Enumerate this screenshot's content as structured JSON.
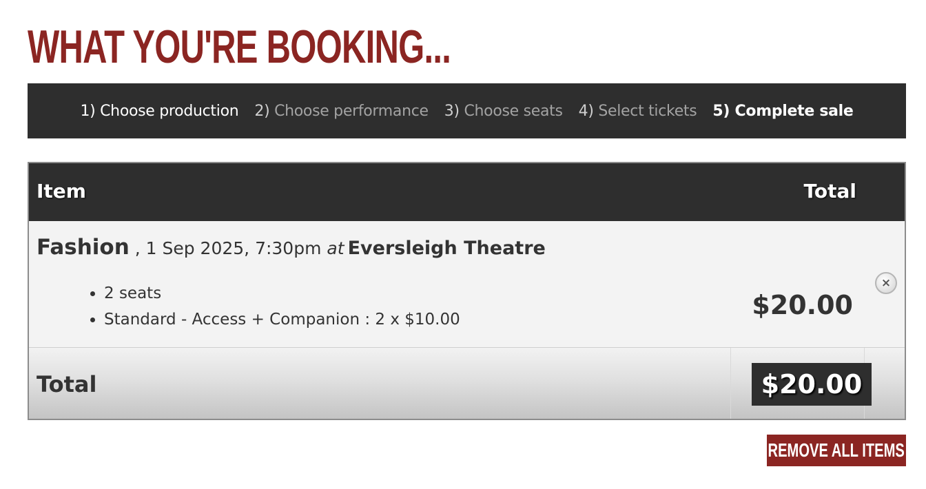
{
  "page": {
    "title": "WHAT YOU'RE BOOKING..."
  },
  "steps": [
    {
      "num": "1)",
      "label": "Choose production",
      "state": "done"
    },
    {
      "num": "2)",
      "label": "Choose performance",
      "state": "inactive"
    },
    {
      "num": "3)",
      "label": "Choose seats",
      "state": "inactive"
    },
    {
      "num": "4)",
      "label": "Select tickets",
      "state": "inactive"
    },
    {
      "num": "5)",
      "label": "Complete sale",
      "state": "active"
    }
  ],
  "cart": {
    "header": {
      "item": "Item",
      "total": "Total"
    },
    "item": {
      "production": "Fashion",
      "date_time": " , 1 Sep 2025, 7:30pm ",
      "at": "at",
      "venue": "Eversleigh Theatre",
      "details": [
        "2 seats",
        "Standard - Access + Companion : 2 x $10.00"
      ],
      "price": "$20.00",
      "remove_symbol": "×"
    },
    "footer": {
      "label": "Total",
      "total": "$20.00"
    }
  },
  "actions": {
    "remove_all": "REMOVE ALL ITEMS"
  },
  "colors": {
    "brand": "#8b2522",
    "dark_bar": "#2e2e2e"
  },
  "icons": {
    "remove_item": "close-circle-icon"
  }
}
